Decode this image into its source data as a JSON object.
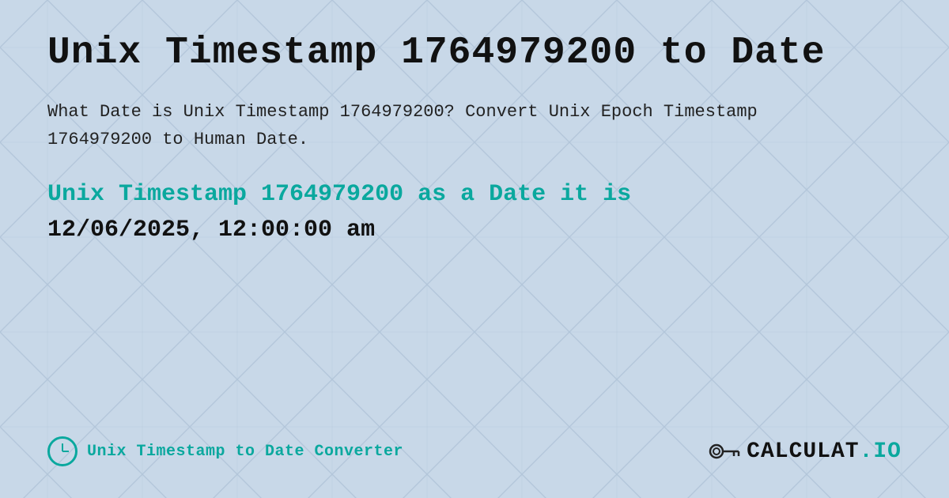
{
  "page": {
    "title": "Unix Timestamp 1764979200 to Date",
    "description": "What Date is Unix Timestamp 1764979200? Convert Unix Epoch Timestamp 1764979200 to Human Date.",
    "result_prefix": "Unix Timestamp 1764979200 as a Date it is",
    "result_value": "12/06/2025, 12:00:00 am",
    "footer_label": "Unix Timestamp to Date Converter",
    "logo_text_prefix": "CALCULAT",
    "logo_text_suffix": ".IO",
    "bg_color": "#c8d8e8",
    "accent_color": "#0aa89e"
  }
}
